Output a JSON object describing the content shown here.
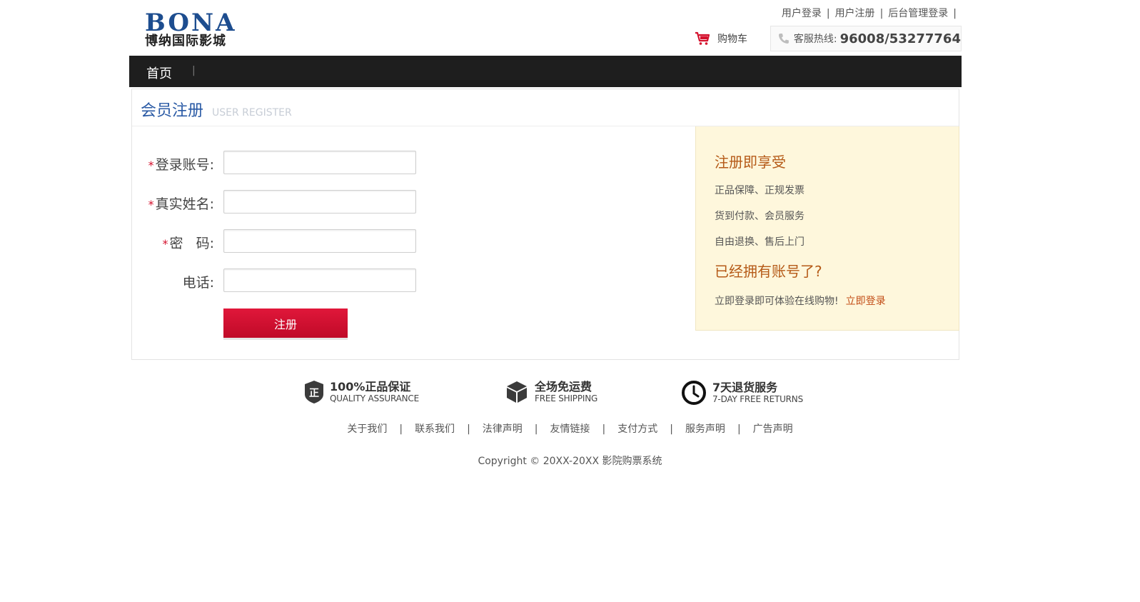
{
  "header": {
    "logo_en": "BONA",
    "logo_cn": "博纳国际影城",
    "top_links": [
      "用户登录",
      "用户注册",
      "后台管理登录"
    ],
    "cart_label": "购物车",
    "hotline_label": "客服热线:",
    "hotline_number": "96008/53277764"
  },
  "nav": {
    "items": [
      "首页"
    ],
    "separator": "|"
  },
  "register": {
    "title_cn": "会员注册",
    "title_en": "USER REGISTER",
    "fields": [
      {
        "label": "登录账号:",
        "required": true,
        "value": ""
      },
      {
        "label": "真实姓名:",
        "required": true,
        "value": ""
      },
      {
        "label": "密   码:",
        "required": true,
        "value": ""
      },
      {
        "label": "电话:",
        "required": false,
        "value": ""
      }
    ],
    "required_mark": "*",
    "submit_label": "注册"
  },
  "benefits": {
    "title": "注册即享受",
    "items": [
      "正品保障、正规发票",
      "货到付款、会员服务",
      "自由退换、售后上门"
    ],
    "has_account_title": "已经拥有账号了?",
    "login_prompt": "立即登录即可体验在线购物!",
    "login_link": "立即登录"
  },
  "features": [
    {
      "icon": "shield-icon",
      "title": "100%正品保证",
      "subtitle": "QUALITY ASSURANCE"
    },
    {
      "icon": "box-icon",
      "title": "全场免运费",
      "subtitle": "FREE SHIPPING"
    },
    {
      "icon": "clock-icon",
      "title": "7天退货服务",
      "subtitle": "7-DAY FREE RETURNS"
    }
  ],
  "footer": {
    "links": [
      "关于我们",
      "联系我们",
      "法律声明",
      "友情链接",
      "支付方式",
      "服务声明",
      "广告声明"
    ],
    "separator": "|",
    "copyright": "Copyright © 20XX-20XX 影院购票系统"
  },
  "colors": {
    "nav_bg": "#1e1e1e",
    "brand_blue": "#2a5aa5",
    "accent_red": "#d4112d",
    "side_bg": "#fef7dc",
    "side_title": "#b55a17"
  }
}
